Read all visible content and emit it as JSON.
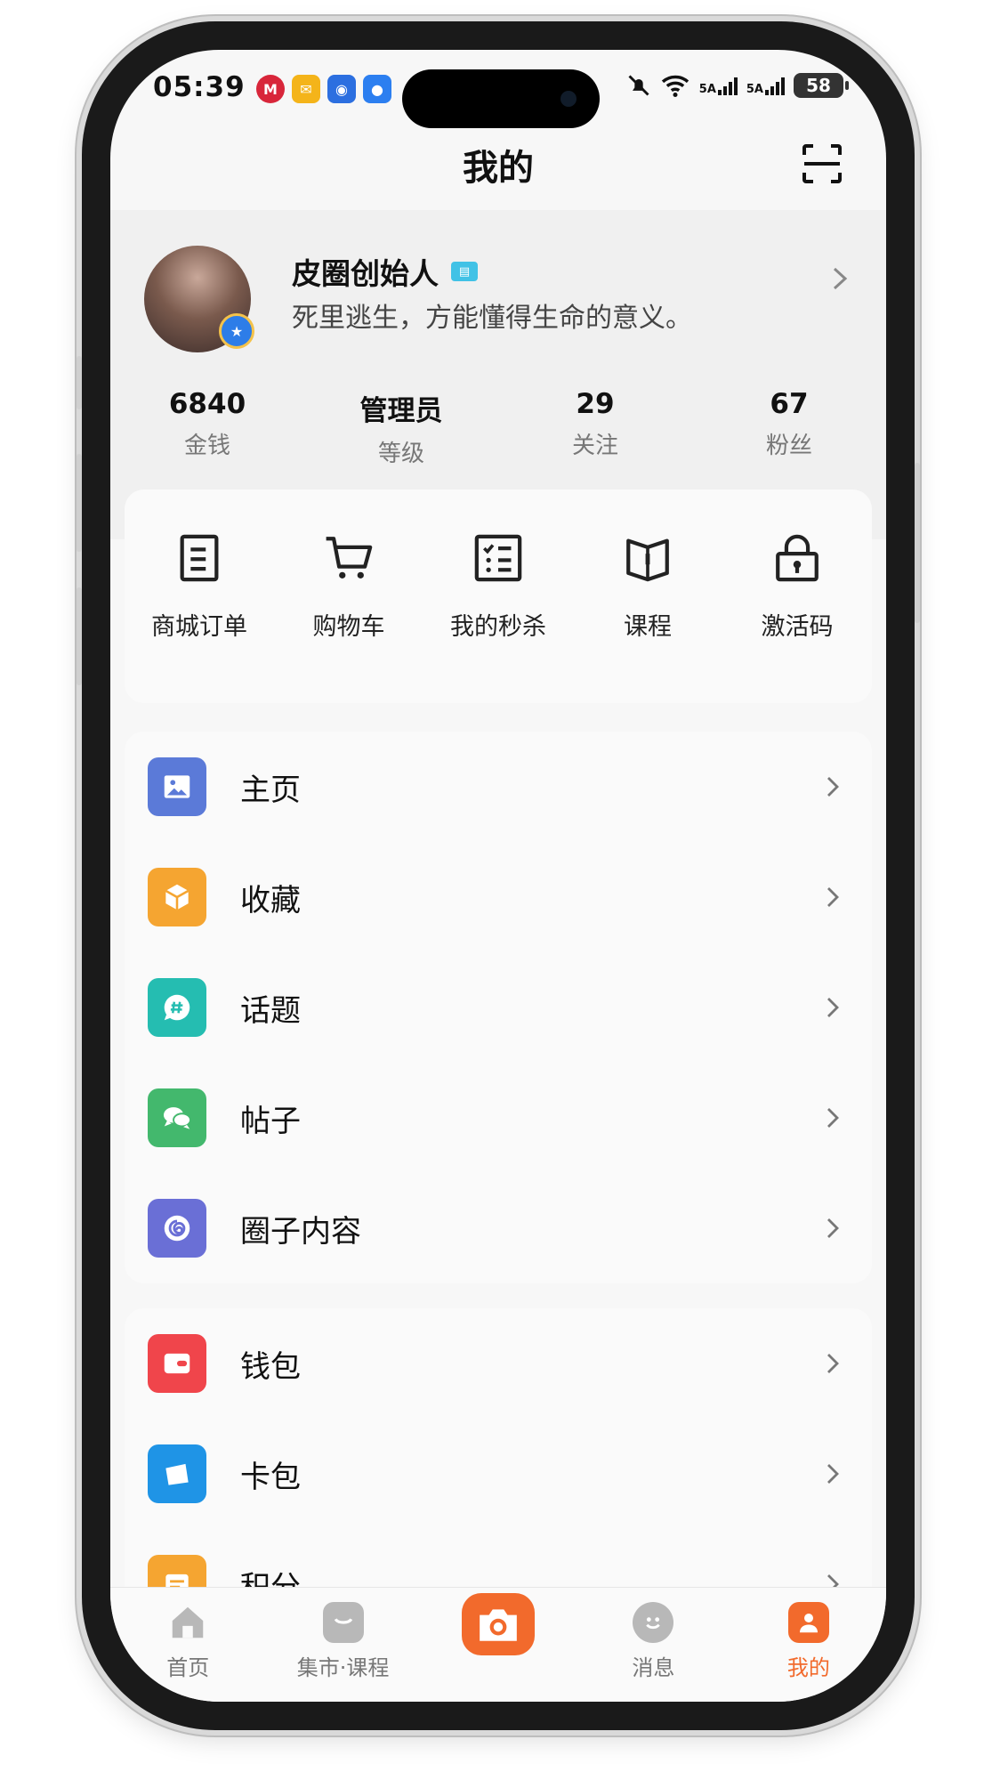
{
  "status_bar": {
    "time": "05:39",
    "signal1": "5A",
    "signal2": "5A",
    "battery": "58"
  },
  "header": {
    "title": "我的"
  },
  "profile": {
    "name": "皮圈创始人",
    "bio": "死里逃生，方能懂得生命的意义。",
    "stats": [
      {
        "value": "6840",
        "label": "金钱"
      },
      {
        "value": "管理员",
        "label": "等级"
      },
      {
        "value": "29",
        "label": "关注"
      },
      {
        "value": "67",
        "label": "粉丝"
      }
    ]
  },
  "quick_actions": [
    {
      "label": "商城订单",
      "icon": "order-list-icon"
    },
    {
      "label": "购物车",
      "icon": "cart-icon"
    },
    {
      "label": "我的秒杀",
      "icon": "checklist-icon"
    },
    {
      "label": "课程",
      "icon": "book-icon"
    },
    {
      "label": "激活码",
      "icon": "lock-icon"
    }
  ],
  "menu_group1": [
    {
      "label": "主页",
      "icon": "image-icon",
      "color": "#5b7ad8"
    },
    {
      "label": "收藏",
      "icon": "cube-icon",
      "color": "#f5a531"
    },
    {
      "label": "话题",
      "icon": "hashtag-icon",
      "color": "#25bdb1"
    },
    {
      "label": "帖子",
      "icon": "chat-icon",
      "color": "#43b86d"
    },
    {
      "label": "圈子内容",
      "icon": "spiral-icon",
      "color": "#6a6fd6"
    }
  ],
  "menu_group2": [
    {
      "label": "钱包",
      "icon": "wallet-icon",
      "color": "#f0454b"
    },
    {
      "label": "卡包",
      "icon": "card-icon",
      "color": "#1f94e6"
    },
    {
      "label": "积分",
      "icon": "points-icon",
      "color": "#f5a531"
    }
  ],
  "tabbar": [
    {
      "label": "首页",
      "icon": "home-icon"
    },
    {
      "label": "集市·课程",
      "icon": "bag-icon"
    },
    {
      "label": "",
      "icon": "camera-icon"
    },
    {
      "label": "消息",
      "icon": "smile-icon"
    },
    {
      "label": "我的",
      "icon": "person-icon"
    }
  ],
  "colors": {
    "accent": "#f26a2c"
  }
}
